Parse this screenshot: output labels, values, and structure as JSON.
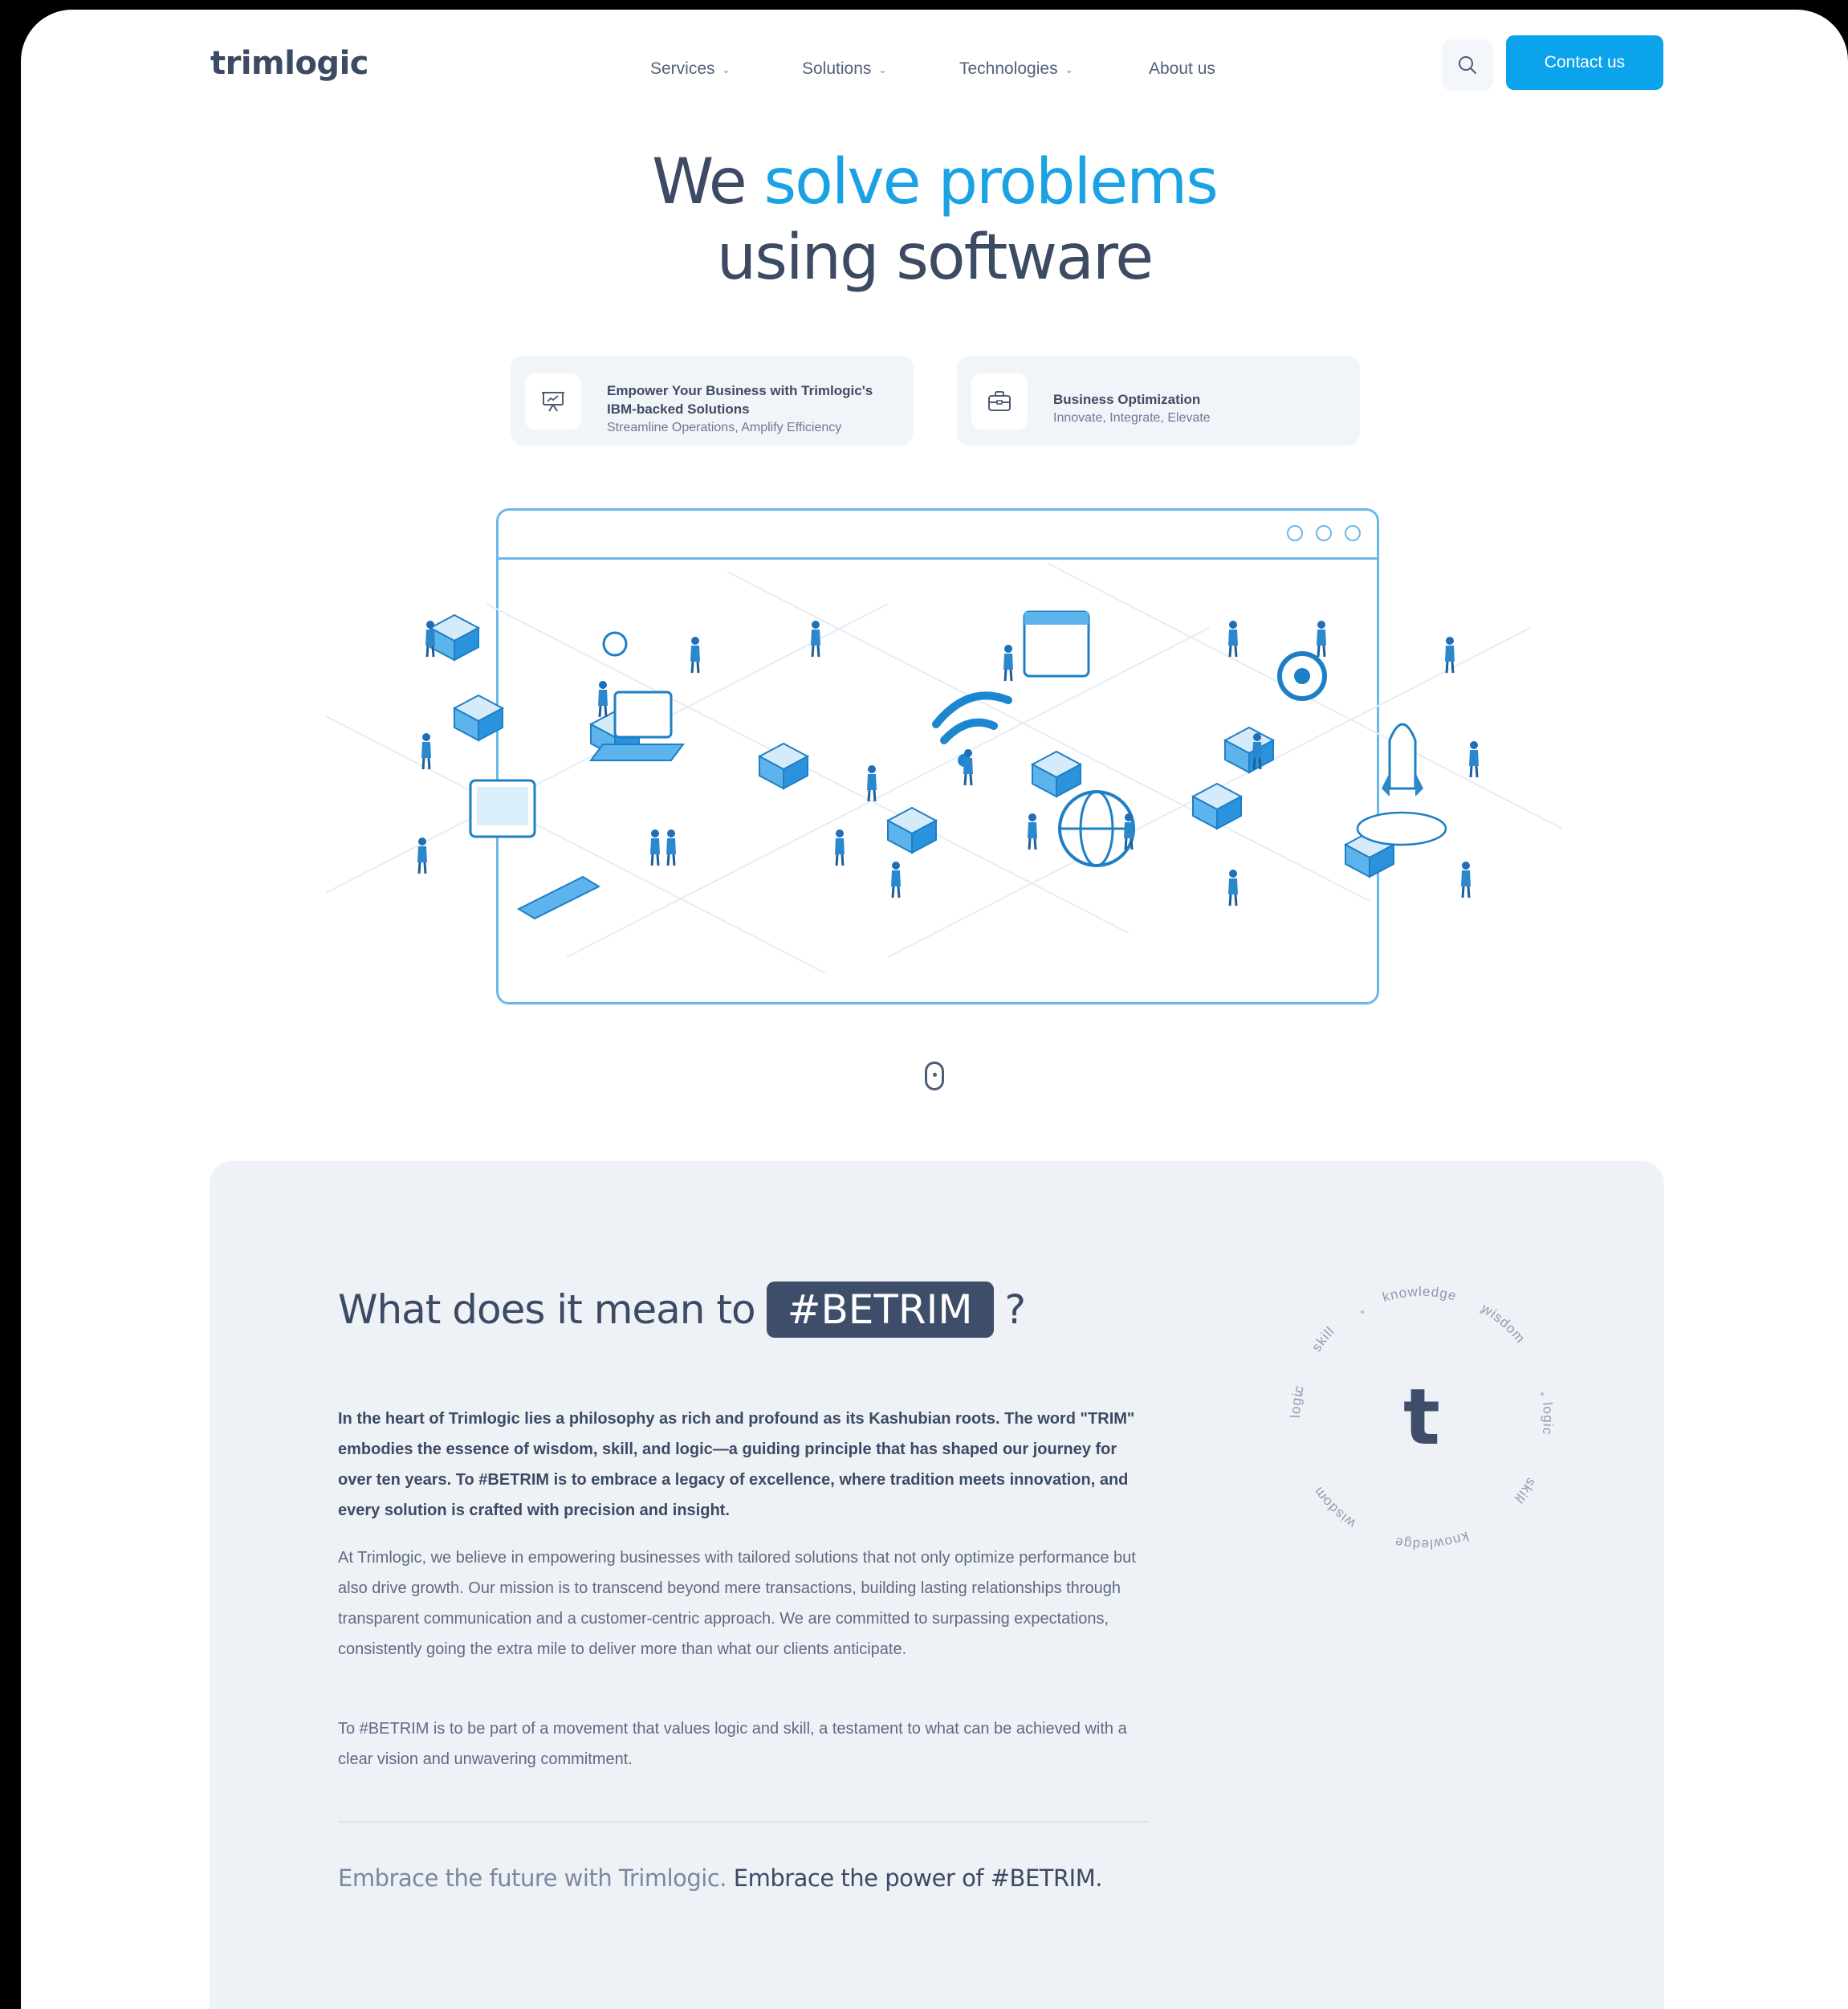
{
  "brand": {
    "logo_text": "trimlogic"
  },
  "nav": {
    "items": [
      {
        "label": "Services",
        "has_dropdown": true
      },
      {
        "label": "Solutions",
        "has_dropdown": true
      },
      {
        "label": "Technologies",
        "has_dropdown": true
      },
      {
        "label": "About us",
        "has_dropdown": false
      }
    ],
    "search_icon": "search-icon",
    "contact_label": "Contact us"
  },
  "hero": {
    "title_lead": "We ",
    "title_accent": "solve problems",
    "title_line2": "using software",
    "cards": [
      {
        "icon": "presentation-icon",
        "title": "Empower Your Business with Trimlogic's IBM-backed Solutions",
        "subtitle": "Streamline Operations, Amplify Efficiency"
      },
      {
        "icon": "briefcase-icon",
        "title": "Business Optimization",
        "subtitle": "Innovate, Integrate, Elevate"
      }
    ]
  },
  "about": {
    "heading_lead": "What does it mean to",
    "heading_tag": "#BETRIM",
    "heading_tail": "?",
    "paragraph_1": "In the heart of Trimlogic lies a philosophy as rich and profound as its Kashubian roots. The word \"TRIM\" embodies the essence of wisdom, skill, and logic—a guiding principle that has shaped our journey for over ten years. To #BETRIM is to embrace a legacy of excellence, where tradition meets innovation, and every solution is crafted with precision and insight.",
    "paragraph_2": "At Trimlogic, we believe in empowering businesses with tailored solutions that not only optimize performance but also drive growth. Our mission is to transcend beyond mere transactions, building lasting relationships through transparent communication and a customer-centric approach. We are committed to surpassing expectations, consistently going the extra mile to deliver more than what our clients anticipate.",
    "paragraph_3": "To #BETRIM is to be part of a movement that values logic and skill, a testament to what can be achieved with a clear vision and unwavering commitment.",
    "closing_light": "Embrace the future with Trimlogic.",
    "closing_strong": " Embrace the power of #BETRIM.",
    "ring": {
      "center_letter": "t",
      "words": [
        "knowledge",
        "wisdom",
        "logic",
        "skill",
        "knowledge",
        "wisdom",
        "logic",
        "skill"
      ]
    }
  },
  "colors": {
    "accent": "#0aa3ec",
    "heading": "#3c4a63",
    "tag_bg": "#3e4d6a",
    "section_bg": "#eef2f7",
    "illustration_stroke": "#6cb8ea"
  }
}
